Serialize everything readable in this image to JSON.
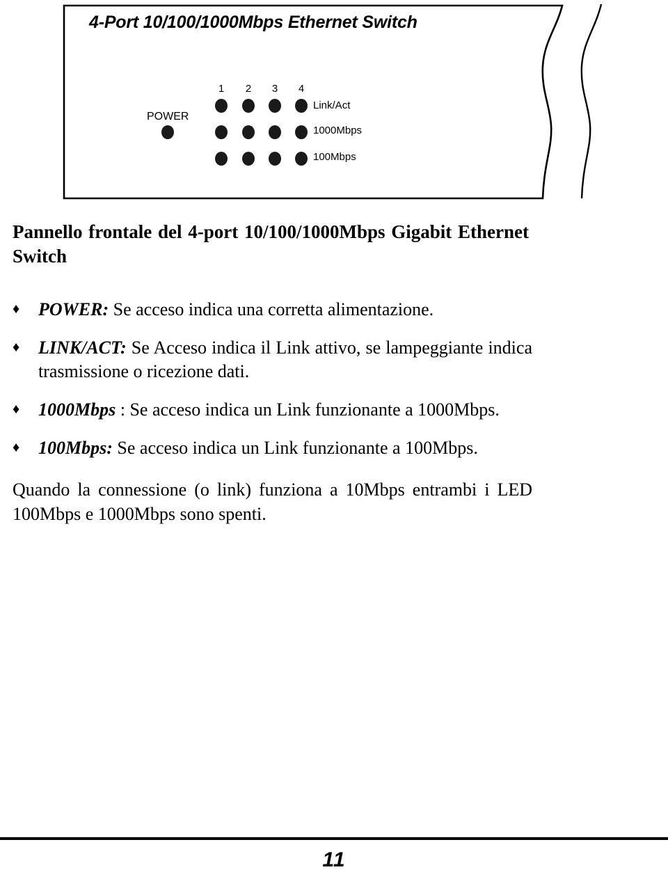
{
  "figure": {
    "title": "4-Port 10/100/1000Mbps Ethernet Switch",
    "power_label": "POWER",
    "port_numbers": [
      "1",
      "2",
      "3",
      "4"
    ],
    "led_rows": [
      {
        "label": "Link/Act",
        "led_count": 4
      },
      {
        "label": "1000Mbps",
        "led_count": 4
      },
      {
        "label": "100Mbps",
        "led_count": 4
      }
    ],
    "led_color": "#1a1a1a",
    "outline_color": "#000000"
  },
  "heading": "Pannello frontale del 4-port 10/100/1000Mbps Gigabit Ethernet Switch",
  "led_list": [
    {
      "bullet": "♦",
      "name": "POWER:",
      "description": " Se acceso indica una corretta alimentazione."
    },
    {
      "bullet": "♦",
      "name": "LINK/ACT:",
      "description": " Se Acceso indica il Link attivo, se lampeggiante indica trasmissione o ricezione dati."
    },
    {
      "bullet": "♦",
      "name": "1000Mbps",
      "description": " : Se acceso indica un Link funzionante a 1000Mbps."
    },
    {
      "bullet": "♦",
      "name": "100Mbps:",
      "description": " Se acceso indica un Link funzionante a 100Mbps."
    }
  ],
  "closing_note": "Quando la connessione (o link) funziona a 10Mbps entrambi i LED 100Mbps e 1000Mbps sono spenti.",
  "footer": {
    "page_number": "11"
  }
}
